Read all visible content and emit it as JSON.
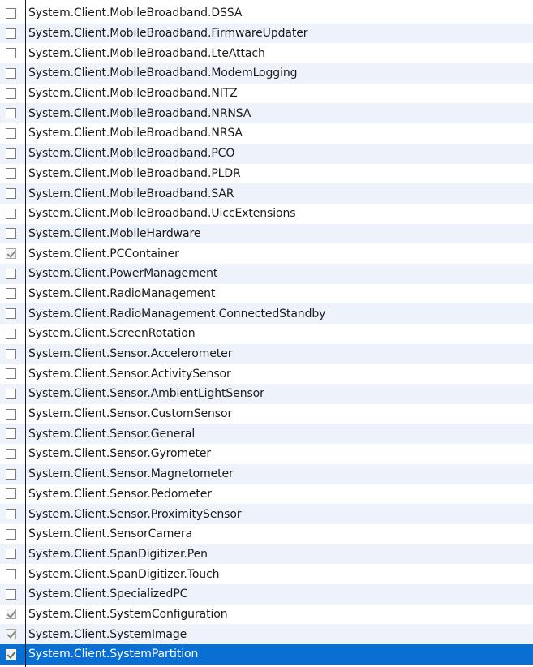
{
  "colors": {
    "alt_row": "#eef3fb",
    "selected_row": "#0a6fd2",
    "selected_text": "#ffffff"
  },
  "features": [
    {
      "label": "System.Client.MobileBroadband.DSSA",
      "checked": false
    },
    {
      "label": "System.Client.MobileBroadband.FirmwareUpdater",
      "checked": false
    },
    {
      "label": "System.Client.MobileBroadband.LteAttach",
      "checked": false
    },
    {
      "label": "System.Client.MobileBroadband.ModemLogging",
      "checked": false
    },
    {
      "label": "System.Client.MobileBroadband.NITZ",
      "checked": false
    },
    {
      "label": "System.Client.MobileBroadband.NRNSA",
      "checked": false
    },
    {
      "label": "System.Client.MobileBroadband.NRSA",
      "checked": false
    },
    {
      "label": "System.Client.MobileBroadband.PCO",
      "checked": false
    },
    {
      "label": "System.Client.MobileBroadband.PLDR",
      "checked": false
    },
    {
      "label": "System.Client.MobileBroadband.SAR",
      "checked": false
    },
    {
      "label": "System.Client.MobileBroadband.UiccExtensions",
      "checked": false
    },
    {
      "label": "System.Client.MobileHardware",
      "checked": false
    },
    {
      "label": "System.Client.PCContainer",
      "checked": true
    },
    {
      "label": "System.Client.PowerManagement",
      "checked": false
    },
    {
      "label": "System.Client.RadioManagement",
      "checked": false
    },
    {
      "label": "System.Client.RadioManagement.ConnectedStandby",
      "checked": false
    },
    {
      "label": "System.Client.ScreenRotation",
      "checked": false
    },
    {
      "label": "System.Client.Sensor.Accelerometer",
      "checked": false
    },
    {
      "label": "System.Client.Sensor.ActivitySensor",
      "checked": false
    },
    {
      "label": "System.Client.Sensor.AmbientLightSensor",
      "checked": false
    },
    {
      "label": "System.Client.Sensor.CustomSensor",
      "checked": false
    },
    {
      "label": "System.Client.Sensor.General",
      "checked": false
    },
    {
      "label": "System.Client.Sensor.Gyrometer",
      "checked": false
    },
    {
      "label": "System.Client.Sensor.Magnetometer",
      "checked": false
    },
    {
      "label": "System.Client.Sensor.Pedometer",
      "checked": false
    },
    {
      "label": "System.Client.Sensor.ProximitySensor",
      "checked": false
    },
    {
      "label": "System.Client.SensorCamera",
      "checked": false
    },
    {
      "label": "System.Client.SpanDigitizer.Pen",
      "checked": false
    },
    {
      "label": "System.Client.SpanDigitizer.Touch",
      "checked": false
    },
    {
      "label": "System.Client.SpecializedPC",
      "checked": false
    },
    {
      "label": "System.Client.SystemConfiguration",
      "checked": true
    },
    {
      "label": "System.Client.SystemImage",
      "checked": true
    },
    {
      "label": "System.Client.SystemPartition",
      "checked": true,
      "selected": true
    }
  ]
}
